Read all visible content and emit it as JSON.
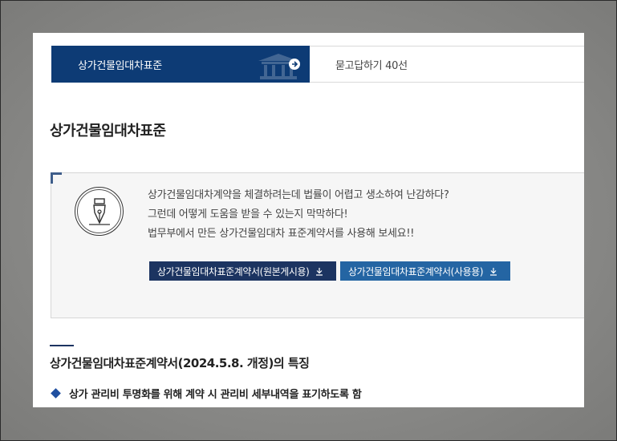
{
  "tabs": {
    "active_label": "상가건물임대차표준",
    "second_label": "묻고답하기 40선"
  },
  "page_title": "상가건물임대차표준",
  "info": {
    "lines": [
      "상가건물임대차계약을 체결하려는데 법률이 어렵고 생소하여 난감하다?",
      "그런데 어떻게 도움을 받을 수 있는지 막막하다!",
      "법무부에서 만든 상가건물임대차 표준계약서를 사용해 보세요!!"
    ],
    "download_buttons": [
      {
        "label": "상가건물임대차표준계약서(원본게시용)",
        "icon": "download-icon"
      },
      {
        "label": "상가건물임대차표준계약서(사용용)",
        "icon": "download-icon"
      }
    ]
  },
  "section": {
    "title": "상가건물임대차표준계약서(2024.5.8. 개정)의 특징",
    "bullets": [
      "상가 관리비 투명화를 위해 계약 시 관리비 세부내역을 표기하도록 함"
    ]
  },
  "colors": {
    "active_tab": "#0d3b75",
    "button_dark": "#1c3461",
    "button_blue": "#2465a3",
    "bullet": "#1f4fa0"
  }
}
